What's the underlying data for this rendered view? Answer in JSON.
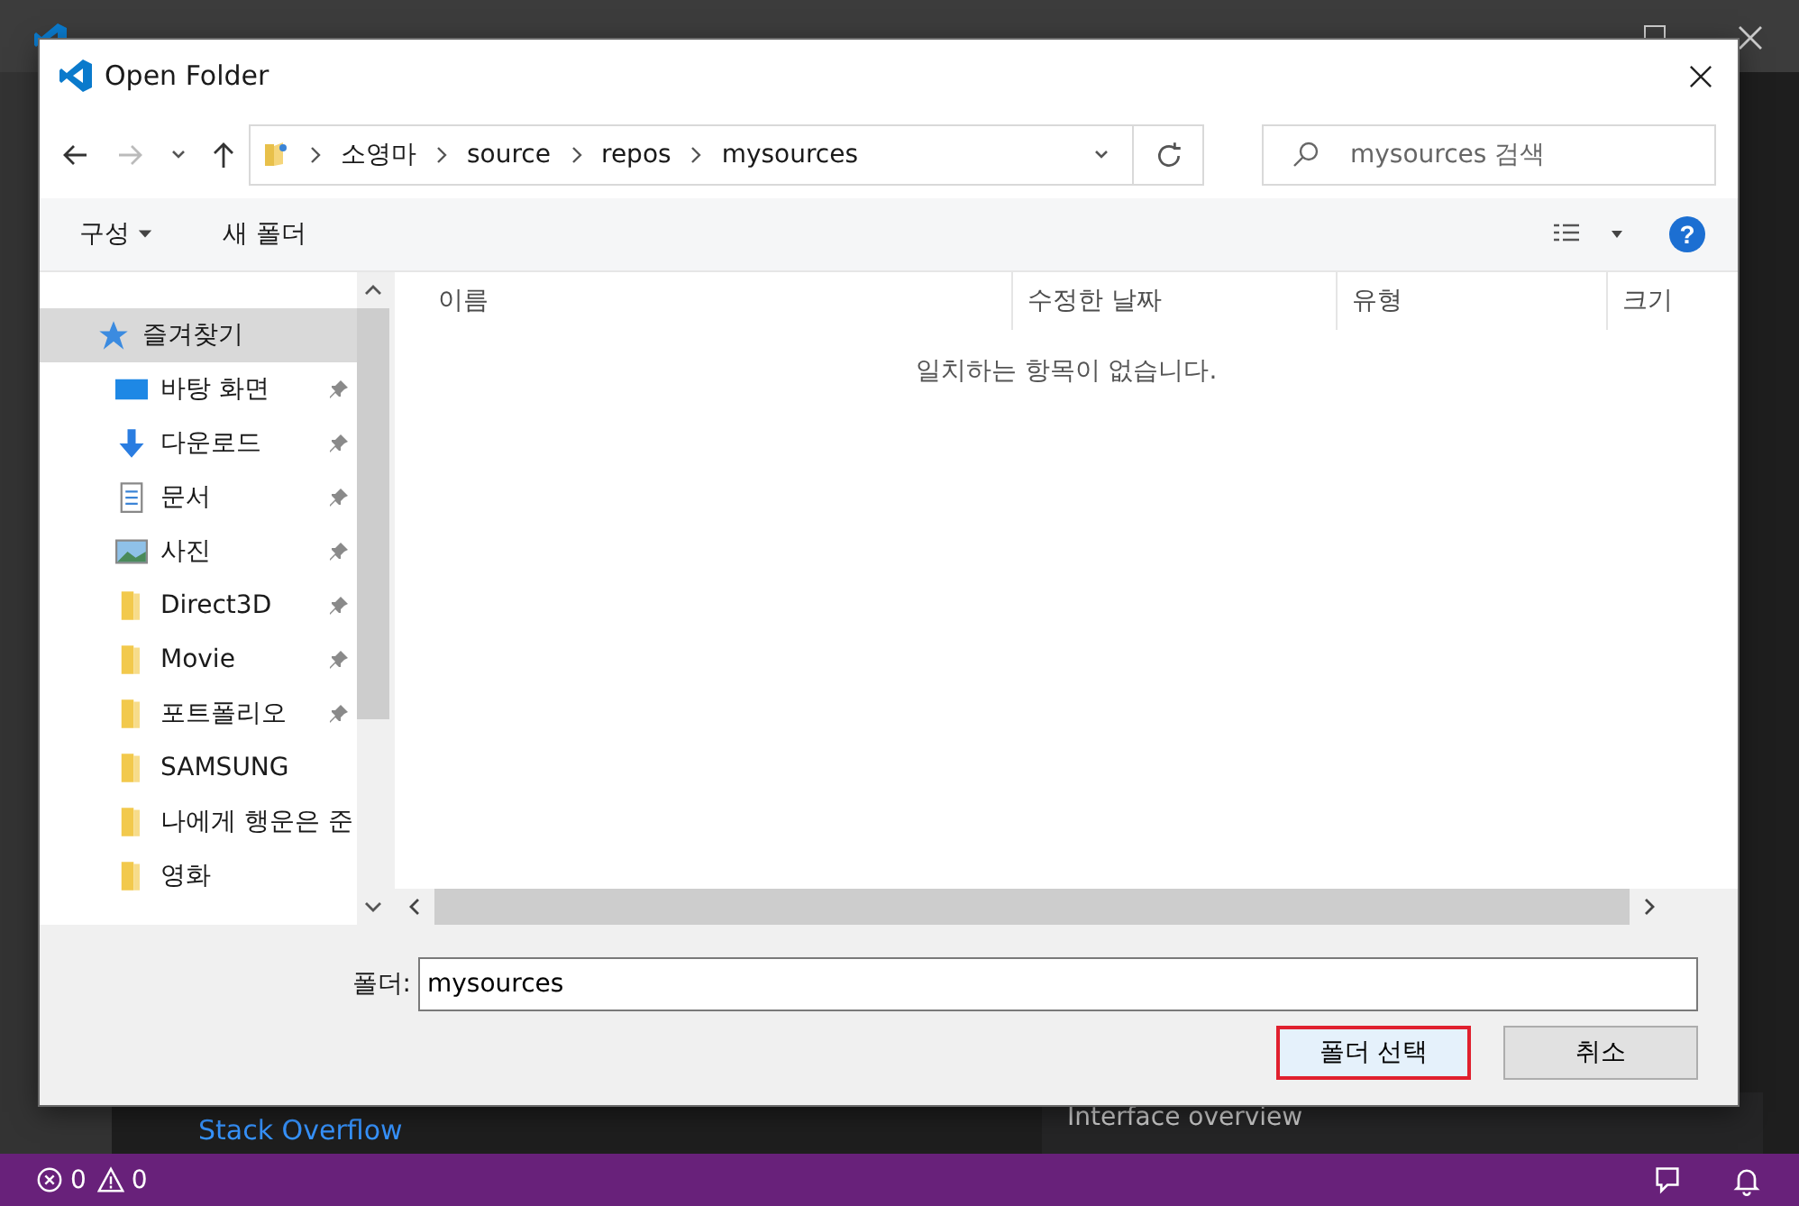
{
  "vscode": {
    "links": [
      "Stack Overflow"
    ],
    "panel_item": "Interface overview"
  },
  "dialog": {
    "title": "Open Folder",
    "help_button": "?",
    "breadcrumb": [
      "소영마",
      "source",
      "repos",
      "mysources"
    ],
    "search": {
      "placeholder": "mysources 검색"
    },
    "toolbar": {
      "organize": "구성",
      "new_folder": "새 폴더"
    },
    "nav": [
      {
        "label": "즐겨찾기",
        "kind": "star",
        "selected": true,
        "pinned": false
      },
      {
        "label": "바탕 화면",
        "kind": "desktop",
        "selected": false,
        "pinned": true
      },
      {
        "label": "다운로드",
        "kind": "download",
        "selected": false,
        "pinned": true
      },
      {
        "label": "문서",
        "kind": "document",
        "selected": false,
        "pinned": true
      },
      {
        "label": "사진",
        "kind": "picture",
        "selected": false,
        "pinned": true
      },
      {
        "label": "Direct3D",
        "kind": "folder",
        "selected": false,
        "pinned": true
      },
      {
        "label": "Movie",
        "kind": "folder",
        "selected": false,
        "pinned": true
      },
      {
        "label": "포트폴리오",
        "kind": "folder",
        "selected": false,
        "pinned": true
      },
      {
        "label": "SAMSUNG",
        "kind": "folder",
        "selected": false,
        "pinned": false
      },
      {
        "label": "나에게 행운은 준",
        "kind": "folder",
        "selected": false,
        "pinned": false
      },
      {
        "label": "영화",
        "kind": "folder",
        "selected": false,
        "pinned": false
      }
    ],
    "columns": [
      "이름",
      "수정한 날짜",
      "유형",
      "크기"
    ],
    "empty_message": "일치하는 항목이 없습니다.",
    "folder_label": "폴더:",
    "folder_value": "mysources",
    "buttons": [
      {
        "label": "폴더 선택",
        "kind": "primary"
      },
      {
        "label": "취소",
        "kind": "normal"
      }
    ]
  },
  "status_bar": {
    "errors": "0",
    "warnings": "0"
  }
}
